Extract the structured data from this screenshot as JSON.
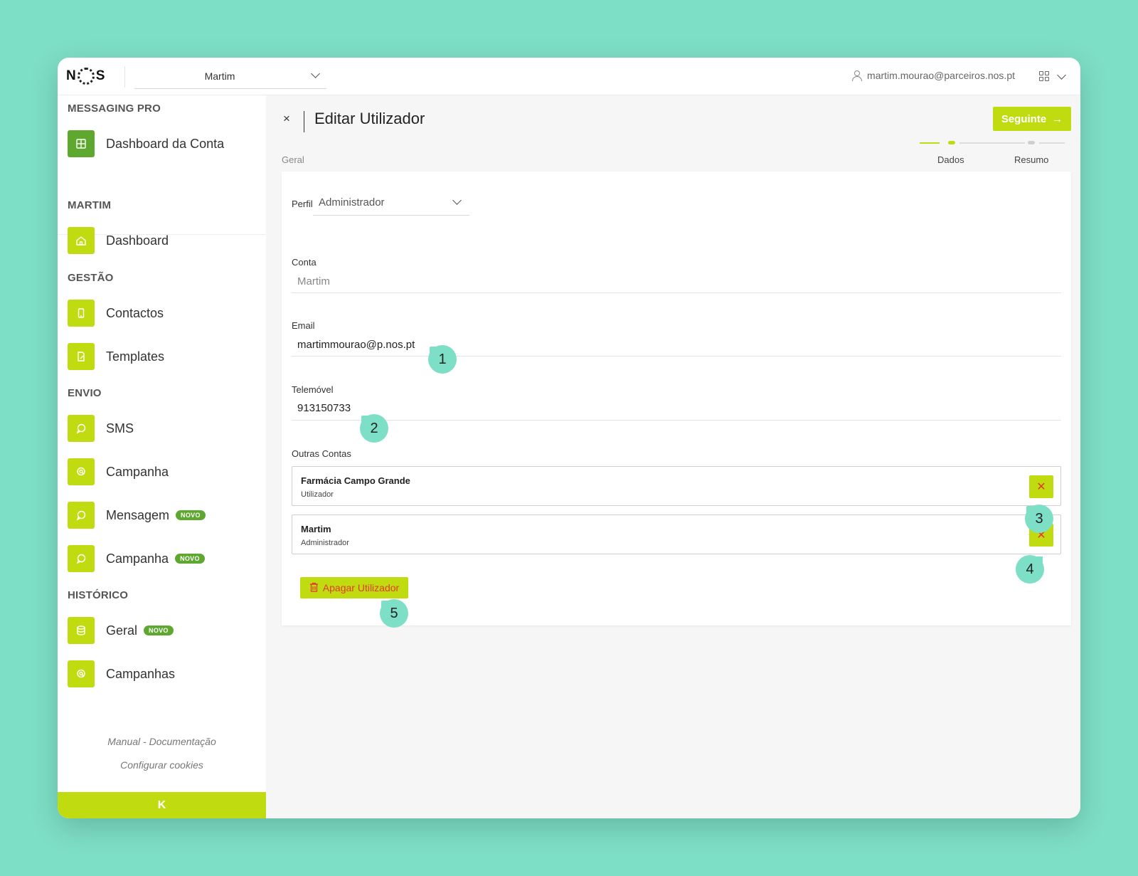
{
  "brand": {
    "logo_left": "N",
    "logo_right": "S",
    "accent": "#c0dc10",
    "accent_dark": "#5fa830",
    "danger": "#e23a2a",
    "backdrop": "#7ddfc5"
  },
  "topbar": {
    "account": "Martim",
    "user_email": "martim.mourao@parceiros.nos.pt"
  },
  "sidebar": {
    "product_title": "MESSAGING PRO",
    "account_dashboard": "Dashboard da Conta",
    "account_section": "MARTIM",
    "dashboard": "Dashboard",
    "gestao_section": "GESTÃO",
    "contactos": "Contactos",
    "templates": "Templates",
    "envio_section": "ENVIO",
    "sms": "SMS",
    "campanha": "Campanha",
    "mensagem": "Mensagem",
    "campanha2": "Campanha",
    "historico_section": "HISTÓRICO",
    "geral": "Geral",
    "campanhas": "Campanhas",
    "badge_new": "NOVO",
    "manual_link": "Manual - Documentação",
    "cookies_link": "Configurar cookies",
    "collapse_label": "K"
  },
  "main": {
    "title": "Editar Utilizador",
    "close": "×",
    "next_label": "Seguinte",
    "section": "Geral",
    "steps": [
      "Dados",
      "Resumo"
    ],
    "perfil_label": "Perfil",
    "perfil_value": "Administrador",
    "conta_label": "Conta",
    "conta_value": "Martim",
    "email_label": "Email",
    "email_value": "martimmourao@p.nos.pt",
    "phone_label": "Telemóvel",
    "phone_value": "913150733",
    "other_accounts_label": "Outras Contas",
    "other_accounts": [
      {
        "name": "Farmácia Campo Grande",
        "role": "Utilizador"
      },
      {
        "name": "Martim",
        "role": "Administrador"
      }
    ],
    "remove_glyph": "✕",
    "delete_label": "Apagar Utilizador"
  },
  "callouts": [
    "1",
    "2",
    "3",
    "4",
    "5"
  ]
}
